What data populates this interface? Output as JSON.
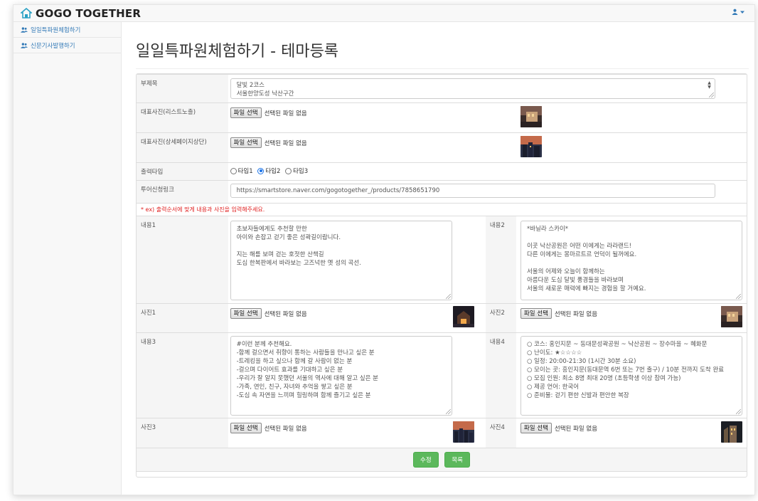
{
  "app": {
    "brand": "GOGO TOGETHER"
  },
  "sidebar": {
    "items": [
      {
        "label": "일일특파원체험하기"
      },
      {
        "label": "신문기사발행하기"
      }
    ]
  },
  "page": {
    "title": "일일특파원체험하기 - 테마등록"
  },
  "form": {
    "subtitle_label": "부제목",
    "subtitle_value": "달빛 2코스\n서울한양도성 낙산구간",
    "main_photo_list_label": "대표사진(리스트노출)",
    "main_photo_detail_label": "대표사진(상세페이지상단)",
    "file_button": "파일 선택",
    "file_status": "선택된 파일 없음",
    "output_type_label": "출력타입",
    "output_types": [
      "타입1",
      "타입2",
      "타입3"
    ],
    "output_selected": "타입2",
    "tour_link_label": "투어신청링크",
    "tour_link_value": "https://smartstore.naver.com/gogotogether_/products/7858651790",
    "notice": "* ex) 출력순서에 맞게 내용과 사진을 입력해주세요.",
    "content1_label": "내용1",
    "content1_value": "초보자들에게도 추천할 만한\n아이와 손잡고 걷기 좋은 성곽길이랍니다.\n\n지는 해를 보며 걷는 호젓한 산책길\n도심 한복판에서 바라보는 고즈넉한 옛 성의 곡선.",
    "content2_label": "내용2",
    "content2_value": "*바닐라 스카이*\n\n이곳 낙산공원은 어떤 이에게는 라라랜드!\n다른 이에게는 몽마르트르 언덕이 될꺼에요.\n\n서울의 어제와 오늘이 함께하는\n아름다운 도심 달빛 풍경들을 바라보며\n서울의 새로운 매력에 빠지는 경험을 할 거예요.",
    "photo1_label": "사진1",
    "photo2_label": "사진2",
    "content3_label": "내용3",
    "content3_value": "#이런 분께 추천해요.\n-함께 걸으면서 취향이 통하는 사람들을 만나고 싶은 분\n-트레킹을 하고 싶으나 함께 갈 사람이 없는 분\n-걸으며 다이어트 효과를 기대하고 싶은 분\n-우리가 잘 알지 못했던 서울의 역사에 대해 알고 싶은 분\n-가족, 연인, 친구, 자녀와 추억을 쌓고 싶은 분\n-도심 속 자연을 느끼며 힐링하며 함께 즐기고 싶은 분",
    "content4_label": "내용4",
    "content4_value": "○ 코스: 홍인지문 ~ 동대문성곽공원 ~ 낙산공원 ~ 장수마을 ~ 혜화문\n○ 난이도: ★☆☆☆☆\n○ 일정: 20:00-21:30 (1시간 30분 소요)\n○ 모이는 곳: 흥인지문(동대문역 6번 또는 7번 출구) / 10분 전까지 도착 완료\n○ 모집 인원: 최소 8명 최대 20명 (초등학생 이상 참여 가능)\n○ 제공 언어: 한국어\n○ 준비물: 걷기 편한 신발과 편안한 복장",
    "photo3_label": "사진3",
    "photo4_label": "사진4",
    "save_button": "수정",
    "list_button": "목록"
  },
  "colors": {
    "accent": "#337ab7",
    "button_green": "#5cb85c",
    "notice_red": "#e02020"
  },
  "icons": {
    "brand": "house-icon",
    "sidebar": "users-icon",
    "user_menu": "user-icon"
  }
}
